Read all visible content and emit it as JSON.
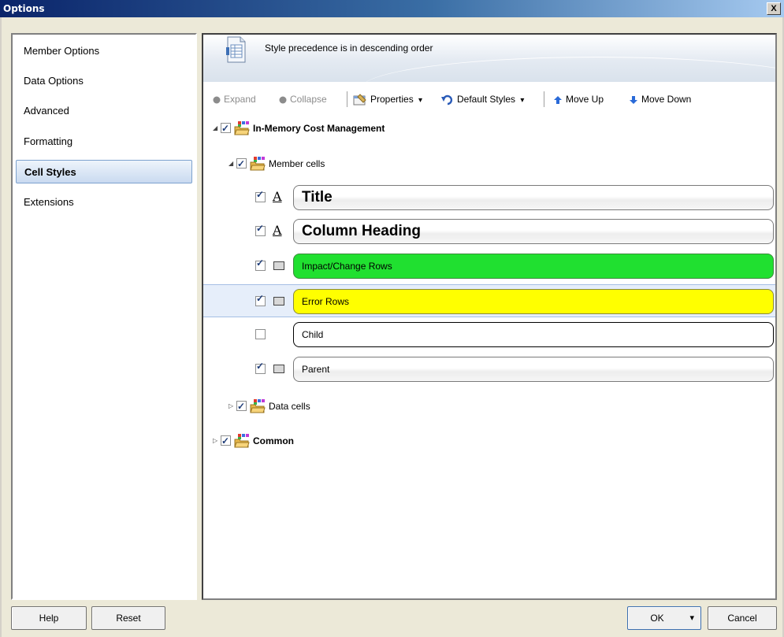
{
  "window": {
    "title": "Options",
    "close_glyph": "X"
  },
  "sidebar": {
    "items": [
      {
        "label": "Member Options",
        "active": false
      },
      {
        "label": "Data Options",
        "active": false
      },
      {
        "label": "Advanced",
        "active": false
      },
      {
        "label": "Formatting",
        "active": false
      },
      {
        "label": "Cell Styles",
        "active": true
      },
      {
        "label": "Extensions",
        "active": false
      }
    ]
  },
  "banner": {
    "text": "Style precedence is in descending order",
    "icon": "document-grid-icon"
  },
  "toolbar": {
    "expand_label": "Expand",
    "collapse_label": "Collapse",
    "properties_label": "Properties",
    "default_styles_label": "Default Styles",
    "move_up_label": "Move Up",
    "move_down_label": "Move Down",
    "dropdown_glyph": "▾"
  },
  "tree": {
    "root": {
      "label": "In-Memory Cost Management",
      "checked": true,
      "expanded": true
    },
    "member_cells": {
      "label": "Member cells",
      "checked": true,
      "expanded": true
    },
    "styles": [
      {
        "label": "Title",
        "checked": true,
        "icon": "font-icon",
        "glyph": "A",
        "variant": "large"
      },
      {
        "label": "Column Heading",
        "checked": true,
        "icon": "font-icon",
        "glyph": "A",
        "variant": "large"
      },
      {
        "label": "Impact/Change Rows",
        "checked": true,
        "icon": "cell-icon",
        "variant": "green",
        "color": "#20e030"
      },
      {
        "label": "Error Rows",
        "checked": true,
        "icon": "cell-icon",
        "variant": "yellow",
        "color": "#ffff00",
        "selected": true
      },
      {
        "label": "Child",
        "checked": false,
        "icon": "none",
        "variant": "plain"
      },
      {
        "label": "Parent",
        "checked": true,
        "icon": "cell-icon",
        "variant": "default"
      }
    ],
    "data_cells": {
      "label": "Data cells",
      "checked": true,
      "expanded": false
    },
    "common": {
      "label": "Common",
      "checked": true,
      "expanded": false
    }
  },
  "footer": {
    "help_label": "Help",
    "reset_label": "Reset",
    "ok_label": "OK",
    "cancel_label": "Cancel",
    "dropdown_glyph": "▾"
  },
  "glyphs": {
    "expanded": "◢",
    "collapsed": "▷"
  }
}
